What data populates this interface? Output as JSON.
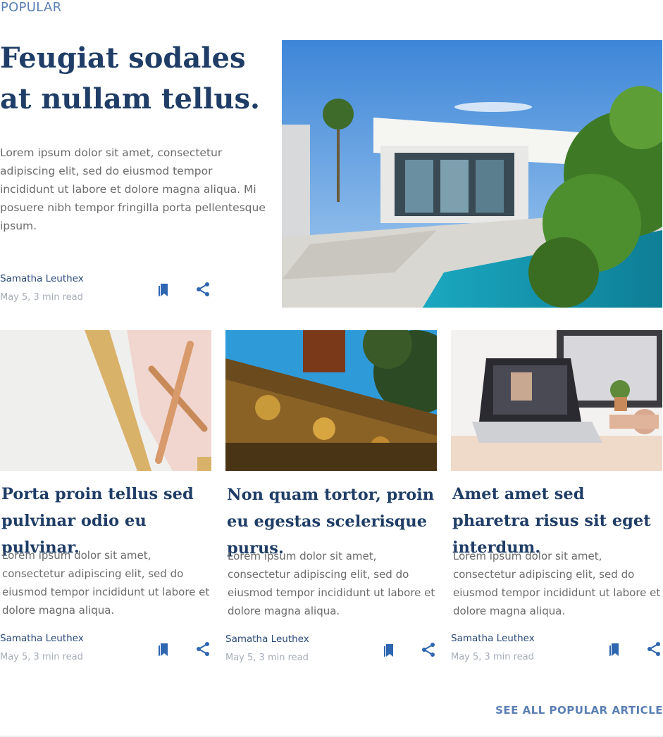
{
  "section": {
    "label": "POPULAR"
  },
  "featured": {
    "title": "Feugiat sodales at nullam tellus.",
    "excerpt": "Lorem ipsum dolor sit amet, consectetur adipiscing elit, sed do eiusmod tempor incididunt ut labore et dolore magna aliqua. Mi posuere nibh tempor fringilla porta pellentesque ipsum.",
    "author": "Samatha Leuthex",
    "date": "May 5, 3 min read",
    "image": "modern-house-pool-photo"
  },
  "cards": [
    {
      "title": "Porta proin tellus sed pulvinar odio eu pulvinar.",
      "excerpt": "Lorem ipsum dolor sit amet, consectetur adipiscing elit, sed do eiusmod tempor incididunt ut labore et dolore magna aliqua.",
      "author": "Samatha Leuthex",
      "date": "May 5, 3 min read",
      "image": "pen-notebook-photo"
    },
    {
      "title": "Non quam tortor, proin eu egestas scelerisque purus.",
      "excerpt": "Lorem ipsum dolor sit amet, consectetur adipiscing elit, sed do eiusmod tempor incididunt ut labore et dolore magna aliqua.",
      "author": "Samatha Leuthex",
      "date": "May 5, 3 min read",
      "image": "temple-roof-photo"
    },
    {
      "title": "Amet amet sed pharetra risus sit eget interdum.",
      "excerpt": "Lorem ipsum dolor sit amet, consectetur adipiscing elit, sed do eiusmod tempor incididunt ut labore et dolore magna aliqua.",
      "author": "Samatha Leuthex",
      "date": "May 5, 3 min read",
      "image": "laptop-desk-photo"
    }
  ],
  "footer": {
    "see_all_label": "SEE ALL POPULAR ARTICLE"
  },
  "icons": {
    "bookmark": "bookmark-icon",
    "share": "share-icon"
  },
  "colors": {
    "title": "#1f3d66",
    "accent": "#2f66b0",
    "label": "#5a7fb3",
    "meta": "#a6adb8"
  }
}
